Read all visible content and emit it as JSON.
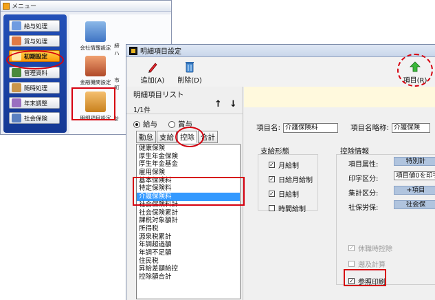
{
  "menu_window": {
    "title": "メニュー",
    "left_items": [
      "給与処理",
      "賞与処理",
      "初期設定",
      "管理資料",
      "随時処理",
      "年末調整",
      "社会保険"
    ],
    "right_tiles": [
      "会社情報設定",
      "金融機関設定",
      "明細項目設定"
    ],
    "right_cut": [
      "締ハ",
      "市町",
      "計"
    ]
  },
  "dialog": {
    "title": "明細項目設定",
    "toolbar": {
      "add_label": "追加(A)",
      "delete_label": "削除(D)",
      "item_label": "項目(R)"
    },
    "list": {
      "title": "明細項目リスト",
      "page": "1/1件",
      "up_arrow": "↑",
      "down_arrow": "↓",
      "radio_salary": "給与",
      "radio_bonus": "賞与",
      "tabs": [
        "勤怠",
        "支給",
        "控除",
        "合計"
      ],
      "items": [
        "健康保険",
        "厚生年金保険",
        "厚生年金基金",
        "雇用保険",
        "基本保険料",
        "特定保険料",
        "介護保険料",
        "社会保険料計",
        "社会保険累計",
        "課税対象額計",
        "所得税",
        "源泉税累計",
        "年調超過額",
        "年調不足額",
        "住民税",
        "昇給差額給控",
        "控除額合計"
      ],
      "selected": "介護保険料"
    },
    "detail": {
      "item_name_label": "項目名:",
      "item_name_value": "介護保険料",
      "item_short_label": "項目名略称:",
      "item_short_value": "介護保険",
      "pay_form": {
        "title": "支給形態",
        "options": [
          {
            "label": "月給制",
            "checked": "✓"
          },
          {
            "label": "日給月給制",
            "checked": "✓"
          },
          {
            "label": "日給制",
            "checked": "✓"
          },
          {
            "label": "時間給制",
            "checked": ""
          }
        ]
      },
      "deduction_info": {
        "title": "控除情報",
        "rows": [
          {
            "label": "項目属性:",
            "value": "特別計"
          },
          {
            "label": "印字区分:",
            "value": "項目値0を印字"
          },
          {
            "label": "集計区分:",
            "value": "+項目"
          },
          {
            "label": "社保労保:",
            "value": "社会保"
          }
        ]
      },
      "leave_deduct": "休職時控除",
      "retro_calc": "遡及計算",
      "ref_print": "参照印刷",
      "ref_print_checked": "✓"
    }
  }
}
